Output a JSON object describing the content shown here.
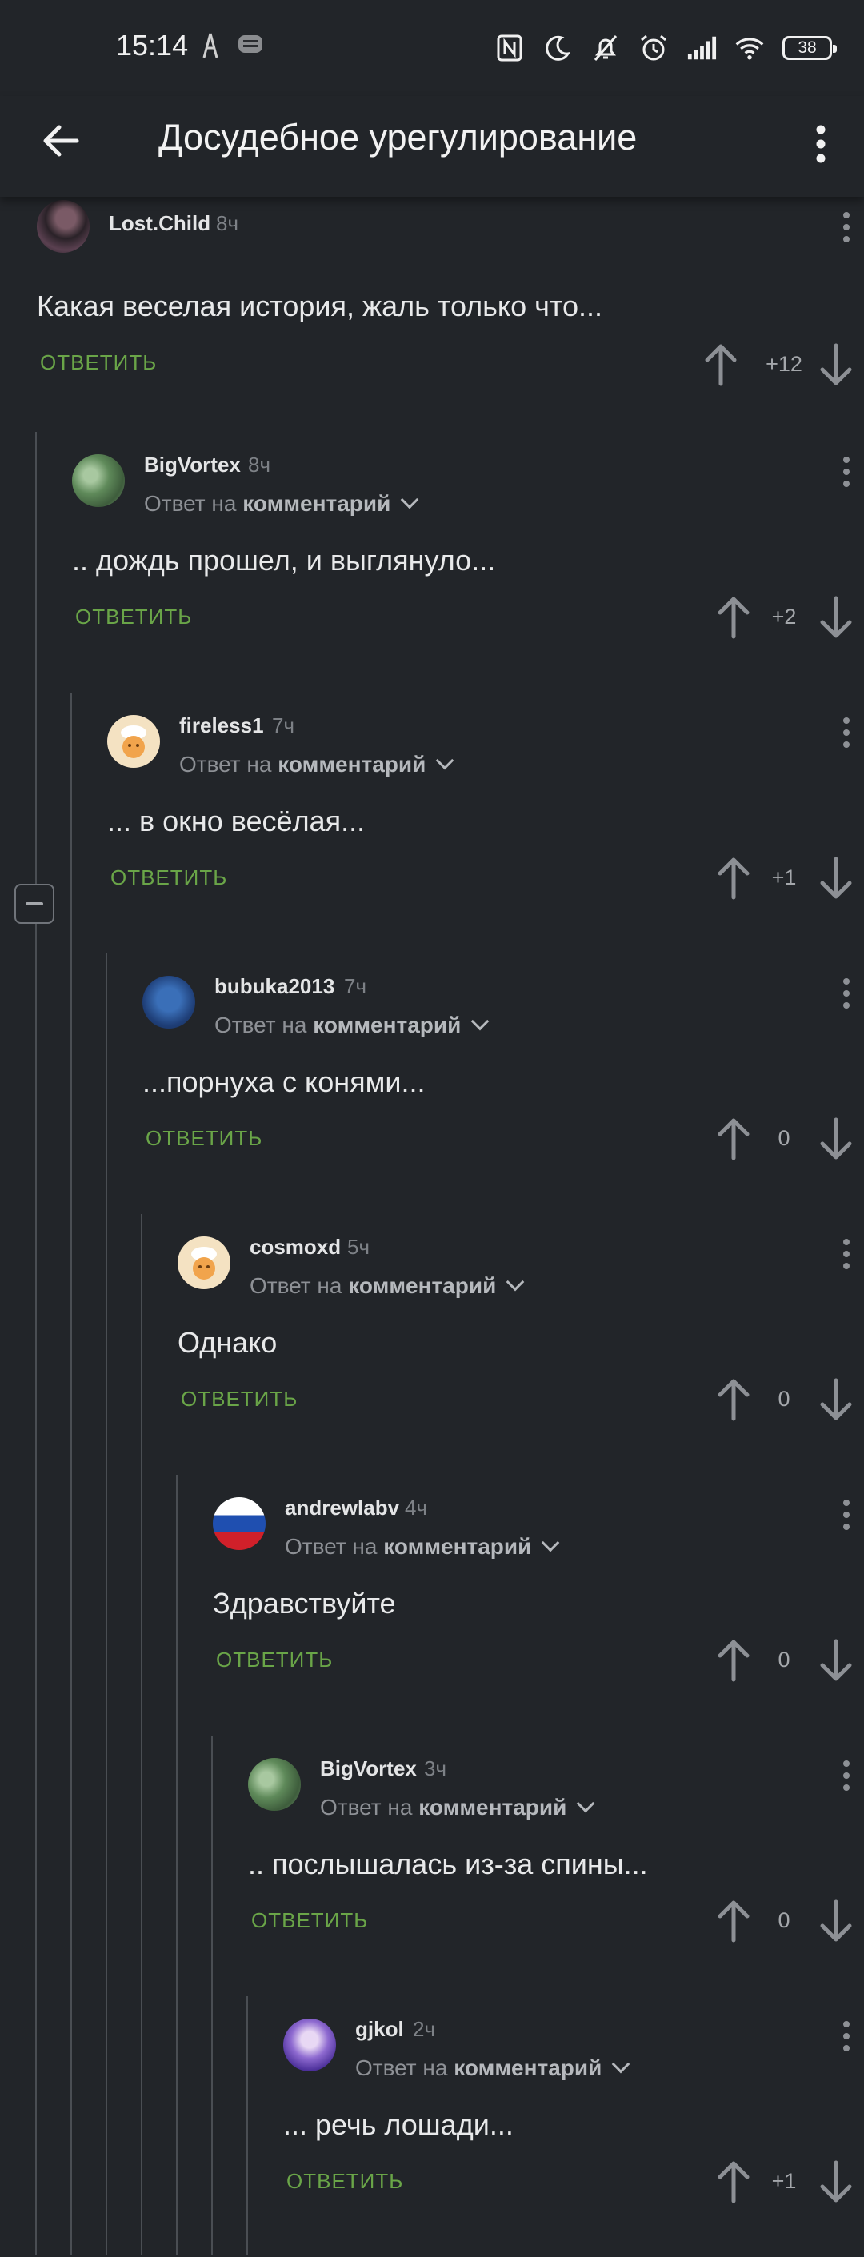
{
  "status_bar": {
    "time": "15:14",
    "icons": [
      "nfc-icon",
      "moon-icon",
      "bell-off-icon",
      "alarm-icon",
      "signal-icon",
      "wifi-icon"
    ],
    "battery": "38"
  },
  "header": {
    "title": "Досудебное урегулирование"
  },
  "reply_label": "ОТВЕТИТЬ",
  "reply_to_prefix": "Ответ на",
  "reply_to_link": "комментарий",
  "comments": [
    {
      "author": "Lost.Child",
      "time": "8ч",
      "text": "Какая веселая история, жаль только что...",
      "score": "+12"
    },
    {
      "author": "BigVortex",
      "time": "8ч",
      "text": ".. дождь прошел, и выглянуло...",
      "score": "+2"
    },
    {
      "author": "fireless1",
      "time": "7ч",
      "text": "... в окно весёлая...",
      "score": "+1"
    },
    {
      "author": "bubuka2013",
      "time": "7ч",
      "text": "...порнуха с конями...",
      "score": "0"
    },
    {
      "author": "cosmoxd",
      "time": "5ч",
      "text": "Однако",
      "score": "0"
    },
    {
      "author": "andrewlabv",
      "time": "4ч",
      "text": "Здравствуйте",
      "score": "0"
    },
    {
      "author": "BigVortex",
      "time": "3ч",
      "text": ".. послышалась из-за спины...",
      "score": "0"
    },
    {
      "author": "gjkol",
      "time": "2ч",
      "text": "... речь лошади...",
      "score": "+1"
    }
  ]
}
